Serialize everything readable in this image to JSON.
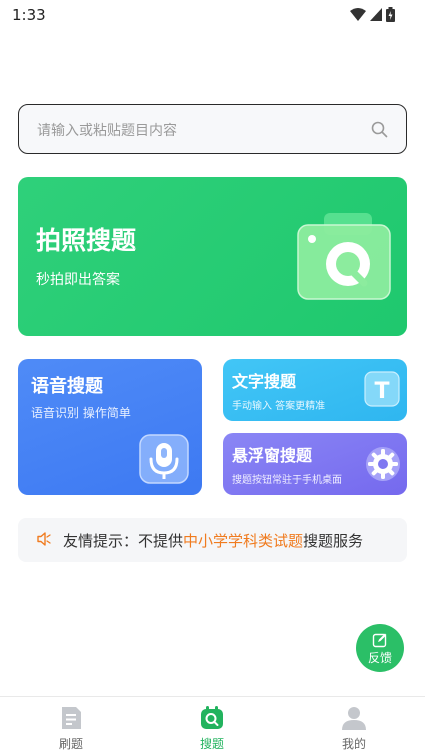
{
  "status_bar": {
    "time": "1:33"
  },
  "search": {
    "placeholder": "请输入或粘贴题目内容"
  },
  "photo_card": {
    "title": "拍照搜题",
    "subtitle": "秒拍即出答案"
  },
  "voice_card": {
    "title": "语音搜题",
    "subtitle": "语音识别 操作简单"
  },
  "text_card": {
    "title": "文字搜题",
    "subtitle": "手动输入 答案更精准",
    "icon_letter": "T"
  },
  "float_card": {
    "title": "悬浮窗搜题",
    "subtitle": "搜题按钮常驻于手机桌面"
  },
  "tip": {
    "prefix": "友情提示：不提供",
    "highlight": "中小学学科类试题",
    "suffix": "搜题服务"
  },
  "feedback": {
    "label": "反馈"
  },
  "tabs": [
    {
      "label": "刷题",
      "icon": "document-icon",
      "active": false
    },
    {
      "label": "搜题",
      "icon": "search-tab-icon",
      "active": true
    },
    {
      "label": "我的",
      "icon": "user-icon",
      "active": false
    }
  ],
  "colors": {
    "photo_card": "#26cc73",
    "voice_card": "#4683f4",
    "text_card": "#3abef3",
    "float_card": "#7f78f1",
    "highlight": "#f07b1f",
    "active_tab": "#22b35e"
  }
}
